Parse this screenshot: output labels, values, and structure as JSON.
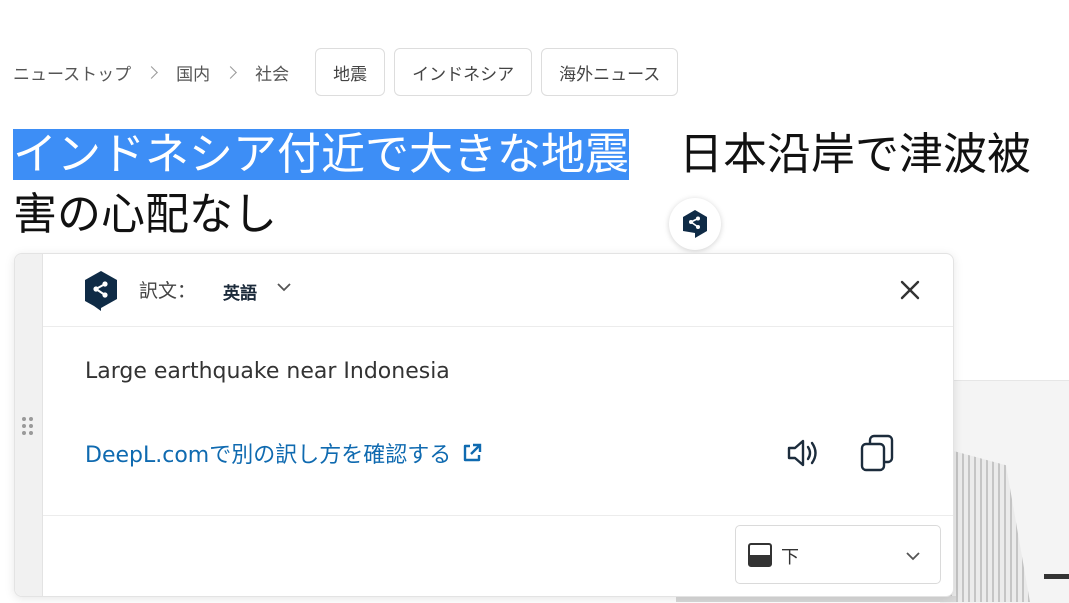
{
  "breadcrumb": {
    "items": [
      "ニューストップ",
      "国内",
      "社会"
    ]
  },
  "tags": [
    "地震",
    "インドネシア",
    "海外ニュース"
  ],
  "headline": {
    "selected": "インドネシア付近で大きな地震",
    "rest": "日本沿岸で津波被害の心配なし"
  },
  "translator": {
    "target_label": "訳文：",
    "target_language": "英語",
    "translation": "Large earthquake near Indonesia",
    "link_text": "DeepL.comで別の訳し方を確認する",
    "position_label": "下"
  },
  "colors": {
    "selection": "#3d8ef6",
    "deepl_navy": "#0f2b46",
    "link": "#0f6ab0"
  },
  "icons": [
    "deepl-logo-icon",
    "chevron-right-icon",
    "chevron-down-icon",
    "close-icon",
    "external-link-icon",
    "speaker-icon",
    "copy-icon",
    "drag-handle-icon",
    "dock-bottom-icon"
  ]
}
